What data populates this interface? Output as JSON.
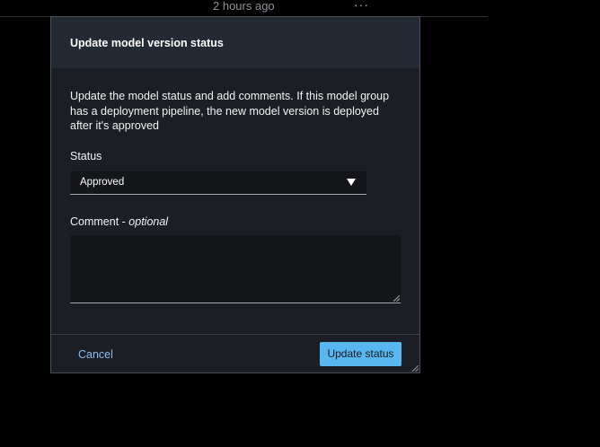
{
  "background_row": {
    "time": "2 hours ago",
    "more": "···"
  },
  "modal": {
    "title": "Update model version status",
    "description": "Update the model status and add comments. If this model group has a deployment pipeline, the new model version is deployed after it's approved",
    "status": {
      "label": "Status",
      "selected": "Approved"
    },
    "comment": {
      "label": "Comment - ",
      "optional": "optional",
      "value": ""
    },
    "cancel_label": "Cancel",
    "submit_label": "Update status"
  },
  "colors": {
    "primary_button": "#58b7ef",
    "link": "#89bdee",
    "header_bg": "#232a34",
    "modal_bg": "#1b1e24"
  },
  "icons": {
    "dropdown": "caret-down-icon",
    "more": "ellipsis-icon"
  }
}
